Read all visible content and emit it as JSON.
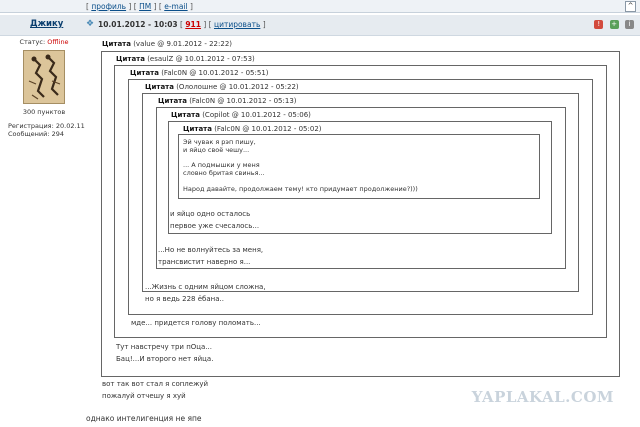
{
  "top_links": {
    "profile": "профиль",
    "pm": "ПМ",
    "email": "e-mail",
    "scroll_top": "^"
  },
  "post": {
    "author": "Джику",
    "date": "10.01.2012 - 10:03",
    "rating": "911",
    "quote_link": "цитировать",
    "icon": "post-pin-icon"
  },
  "user": {
    "status_label": "Статус:",
    "status_value": "Offline",
    "points": "300 пунктов",
    "reg_label": "Регистрация:",
    "reg_date": "20.02.11",
    "msgs_label": "Сообщений:",
    "msgs_count": "294"
  },
  "quotes": [
    {
      "header_label": "Цитата",
      "meta": "(value @ 9.01.2012 - 22:22)",
      "text": [
        "вот так вот стал я соплежуй",
        "пожалуй отчешу я хуй"
      ]
    },
    {
      "header_label": "Цитата",
      "meta": "(esaulZ @ 10.01.2012 - 07:53)",
      "text": [
        "Тут навстречу три пОца...",
        "Бац!...И второго нет яйца."
      ]
    },
    {
      "header_label": "Цитата",
      "meta": "(Falc0N @ 10.01.2012 - 05:51)",
      "text": [
        "мде... придется голову поломать..."
      ]
    },
    {
      "header_label": "Цитата",
      "meta": "(Ололошне @ 10.01.2012 - 05:22)",
      "text": [
        "...Жизнь с одним яйцом сложна,",
        "но я ведь 228 ёбана.."
      ]
    },
    {
      "header_label": "Цитата",
      "meta": "(Falc0N @ 10.01.2012 - 05:13)",
      "text": [
        "...Но не волнуйтесь за меня,",
        "трансвистит наверно я..."
      ]
    },
    {
      "header_label": "Цитата",
      "meta": "(Copilot @ 10.01.2012 - 05:06)",
      "text": [
        "и яйцо одно осталось",
        "первое уже счесалось..."
      ]
    },
    {
      "header_label": "Цитата",
      "meta": "(Falc0N @ 10.01.2012 - 05:02)",
      "text": [
        "Эй чувак я рэп пишу,\nи яйцо своё чешу...\n\n... А подмышки у меня\nсловно бритая свинья...\n\nНарод давайте, продолжаем тему! кто придумает продолжение?)))"
      ]
    }
  ],
  "bottom_text": "однако интелигенция не япе",
  "watermark": "YAPLAKAL.COM",
  "colors": {
    "header_bg": "#e6ebf0",
    "link": "#0b4f8a",
    "rating": "#cc0000",
    "offline": "#cc0000"
  }
}
